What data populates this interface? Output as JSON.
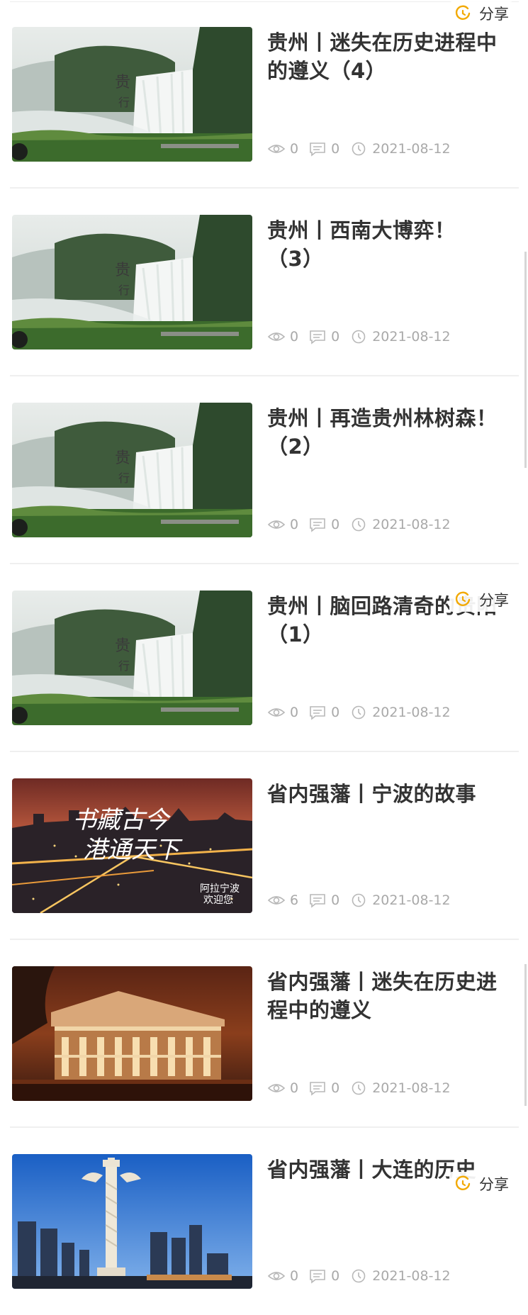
{
  "share_label": "分享",
  "articles": [
    {
      "title": "贵州丨迷失在历史进程中的遵义（4）",
      "thumb": "waterfall-image",
      "views": "0",
      "comments": "0",
      "date": "2021-08-12"
    },
    {
      "title": "贵州丨西南大博弈！（3）",
      "thumb": "waterfall-image",
      "views": "0",
      "comments": "0",
      "date": "2021-08-12"
    },
    {
      "title": "贵州丨再造贵州林树森！ （2）",
      "thumb": "waterfall-image",
      "views": "0",
      "comments": "0",
      "date": "2021-08-12"
    },
    {
      "title": "贵州丨脑回路清奇的贵阳（1）",
      "thumb": "waterfall-image",
      "views": "0",
      "comments": "0",
      "date": "2021-08-12"
    },
    {
      "title": "省内强藩丨宁波的故事",
      "thumb": "city-night-image",
      "views": "6",
      "comments": "0",
      "date": "2021-08-12"
    },
    {
      "title": "省内强藩丨迷失在历史进程中的遵义",
      "thumb": "historic-building-image",
      "views": "0",
      "comments": "0",
      "date": "2021-08-12"
    },
    {
      "title": "省内强藩丨大连的历史",
      "thumb": "monument-image",
      "views": "0",
      "comments": "0",
      "date": "2021-08-12"
    }
  ],
  "colors": {
    "title": "#333333",
    "meta": "#a9a9a9",
    "share_icon": "#f2a900"
  }
}
